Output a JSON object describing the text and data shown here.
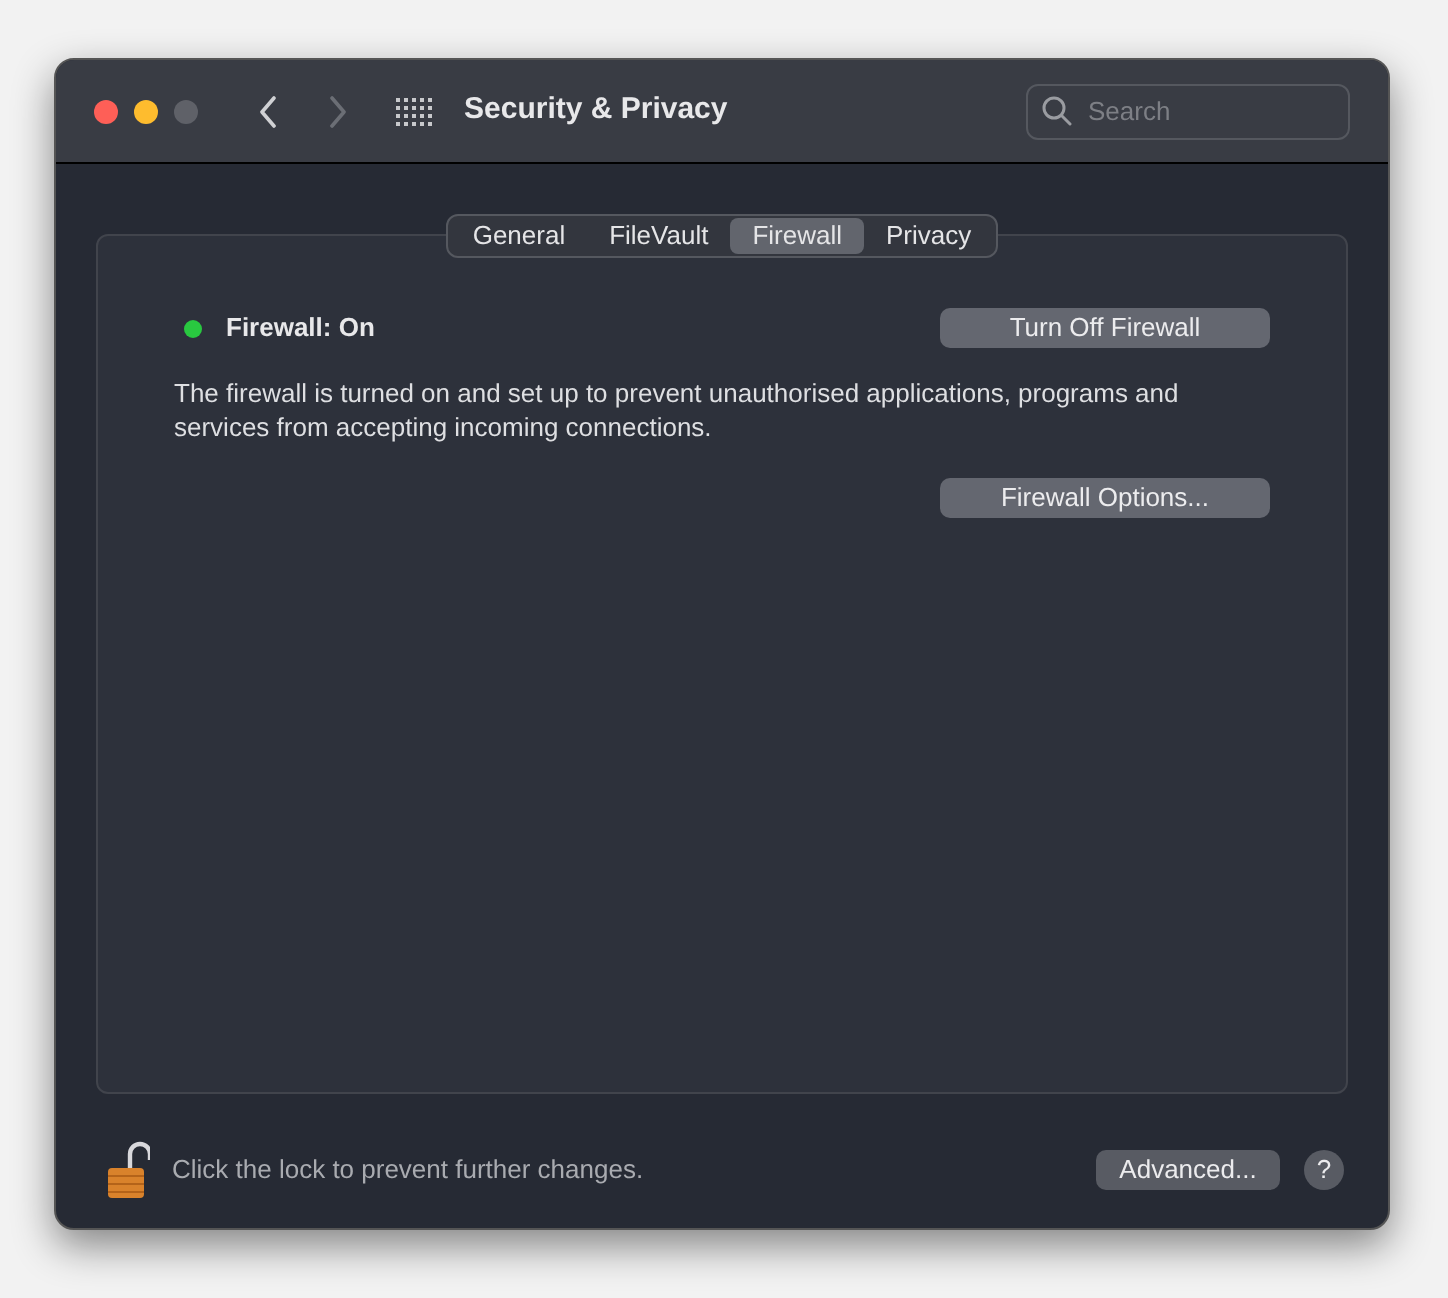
{
  "window": {
    "title": "Security & Privacy"
  },
  "toolbar": {
    "back_disabled": false,
    "forward_disabled": true,
    "search": {
      "placeholder": "Search"
    }
  },
  "tabs": [
    {
      "label": "General",
      "selected": false
    },
    {
      "label": "FileVault",
      "selected": false
    },
    {
      "label": "Firewall",
      "selected": true
    },
    {
      "label": "Privacy",
      "selected": false
    }
  ],
  "firewall": {
    "status": "Firewall: On",
    "on": true,
    "toggle_button": "Turn Off Firewall",
    "description": "The firewall is turned on and set up to prevent unauthorised applications, programs and services from accepting incoming connections.",
    "options_button": "Firewall Options..."
  },
  "footer": {
    "locked": false,
    "lock_text": "Click the lock to prevent further changes.",
    "advanced_button": "Advanced...",
    "help": "?"
  }
}
